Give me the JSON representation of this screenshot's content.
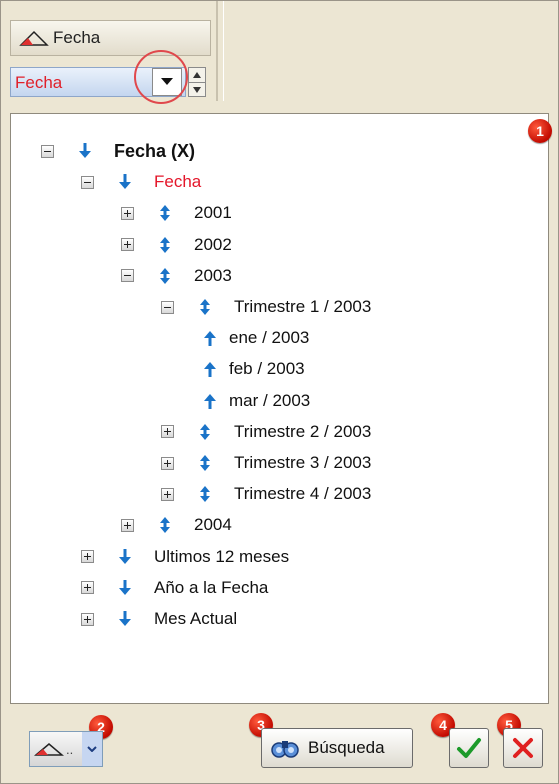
{
  "header": {
    "column_label": "Fecha",
    "combo_value": "Fecha"
  },
  "tree": [
    {
      "label": "Fecha (X)",
      "level": 0,
      "expander": "minus",
      "arrow": "down",
      "bold": true
    },
    {
      "label": "Fecha",
      "level": 1,
      "expander": "minus",
      "arrow": "down",
      "red": true
    },
    {
      "label": "2001",
      "level": 2,
      "expander": "plus",
      "arrow": "updown"
    },
    {
      "label": "2002",
      "level": 2,
      "expander": "plus",
      "arrow": "updown"
    },
    {
      "label": "2003",
      "level": 2,
      "expander": "minus",
      "arrow": "updown"
    },
    {
      "label": "Trimestre 1 / 2003",
      "level": 3,
      "expander": "minus",
      "arrow": "updown"
    },
    {
      "label": "ene / 2003",
      "level": 4,
      "expander": "none",
      "arrow": "up"
    },
    {
      "label": "feb / 2003",
      "level": 4,
      "expander": "none",
      "arrow": "up"
    },
    {
      "label": "mar / 2003",
      "level": 4,
      "expander": "none",
      "arrow": "up"
    },
    {
      "label": "Trimestre 2 / 2003",
      "level": 3,
      "expander": "plus",
      "arrow": "updown"
    },
    {
      "label": "Trimestre 3 / 2003",
      "level": 3,
      "expander": "plus",
      "arrow": "updown"
    },
    {
      "label": "Trimestre 4 / 2003",
      "level": 3,
      "expander": "plus",
      "arrow": "updown"
    },
    {
      "label": "2004",
      "level": 2,
      "expander": "plus",
      "arrow": "updown"
    },
    {
      "label": "Ultimos 12 meses",
      "level": 1,
      "expander": "plus",
      "arrow": "down"
    },
    {
      "label": "Año a la Fecha",
      "level": 1,
      "expander": "plus",
      "arrow": "down"
    },
    {
      "label": "Mes Actual",
      "level": 1,
      "expander": "plus",
      "arrow": "down"
    }
  ],
  "badges": [
    "1",
    "2",
    "3",
    "4",
    "5"
  ],
  "footer": {
    "dropdown_dots": "..",
    "search_label": "Búsqueda"
  },
  "colors": {
    "selected_text": "#e4162a",
    "arrow_blue": "#1a73c8",
    "badge_red": "#c20a00",
    "ok_green": "#1c9a2a",
    "cancel_red": "#e02020"
  },
  "icons": {
    "column": "triangle-chart-icon",
    "combo": "dropdown-arrow-icon",
    "search": "binoculars-icon",
    "ok": "checkmark-icon",
    "cancel": "x-icon"
  }
}
